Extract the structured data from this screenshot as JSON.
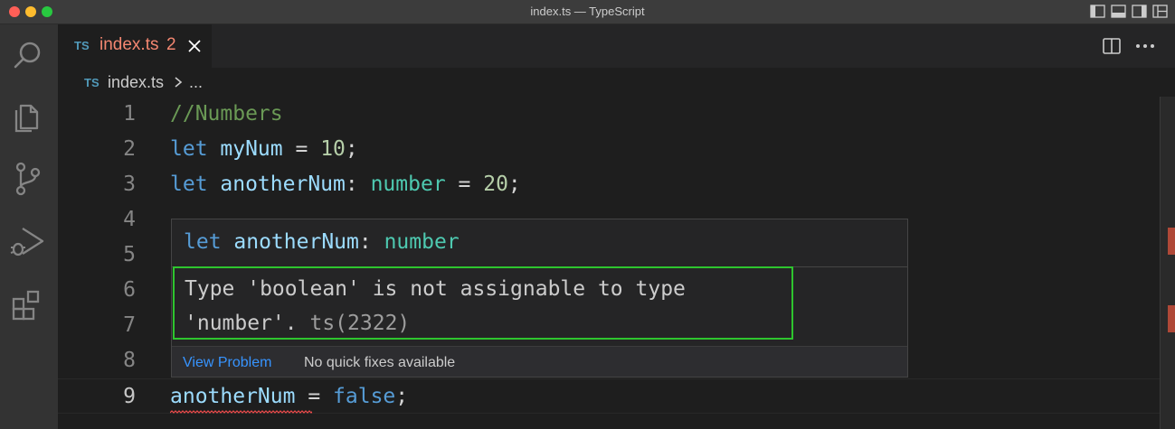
{
  "window": {
    "title": "index.ts — TypeScript"
  },
  "tab": {
    "lang_badge": "TS",
    "filename": "index.ts",
    "problem_count": "2"
  },
  "breadcrumb": {
    "lang_badge": "TS",
    "file": "index.ts",
    "more": "..."
  },
  "editor": {
    "lines": [
      {
        "num": "1",
        "tokens": [
          {
            "t": "//Numbers",
            "c": "cmt"
          }
        ]
      },
      {
        "num": "2",
        "tokens": [
          {
            "t": "let ",
            "c": "kw"
          },
          {
            "t": "myNum",
            "c": "var"
          },
          {
            "t": " = ",
            "c": "op"
          },
          {
            "t": "10",
            "c": "num"
          },
          {
            "t": ";",
            "c": "op"
          }
        ]
      },
      {
        "num": "3",
        "tokens": [
          {
            "t": "let ",
            "c": "kw"
          },
          {
            "t": "anotherNum",
            "c": "var"
          },
          {
            "t": ": ",
            "c": "op"
          },
          {
            "t": "number",
            "c": "typ"
          },
          {
            "t": " = ",
            "c": "op"
          },
          {
            "t": "20",
            "c": "num"
          },
          {
            "t": ";",
            "c": "op"
          }
        ]
      },
      {
        "num": "4",
        "tokens": []
      },
      {
        "num": "5",
        "tokens": []
      },
      {
        "num": "6",
        "tokens": []
      },
      {
        "num": "7",
        "tokens": []
      },
      {
        "num": "8",
        "tokens": []
      },
      {
        "num": "9",
        "tokens": [
          {
            "t": "anotherNum",
            "c": "var"
          },
          {
            "t": " = ",
            "c": "op"
          },
          {
            "t": "false",
            "c": "kw"
          },
          {
            "t": ";",
            "c": "op"
          }
        ]
      }
    ],
    "active_line": "9"
  },
  "hover": {
    "signature": [
      {
        "t": "let ",
        "c": "kw"
      },
      {
        "t": "anotherNum",
        "c": "var"
      },
      {
        "t": ": ",
        "c": "op"
      },
      {
        "t": "number",
        "c": "typ"
      }
    ],
    "message_line1": "Type 'boolean' is not assignable to type",
    "message_line2": "'number'.",
    "error_code": "ts(2322)",
    "view_problem": "View Problem",
    "no_quick_fix": "No quick fixes available"
  },
  "icons": {
    "activity_bar": [
      "search-icon",
      "explorer-icon",
      "source-control-icon",
      "run-debug-icon",
      "extensions-icon"
    ],
    "tab_close": "close-icon",
    "editor_actions": [
      "split-editor-icon",
      "more-actions-icon"
    ],
    "layout": [
      "toggle-primary-sidebar-icon",
      "toggle-panel-icon",
      "toggle-secondary-sidebar-icon",
      "customize-layout-icon"
    ]
  },
  "colors": {
    "keyword": "#569cd6",
    "variable": "#9cdcfe",
    "number": "#b5cea8",
    "type": "#4ec9b0",
    "comment": "#6a9955",
    "error": "#f48771",
    "highlight_box": "#2ec52e"
  }
}
